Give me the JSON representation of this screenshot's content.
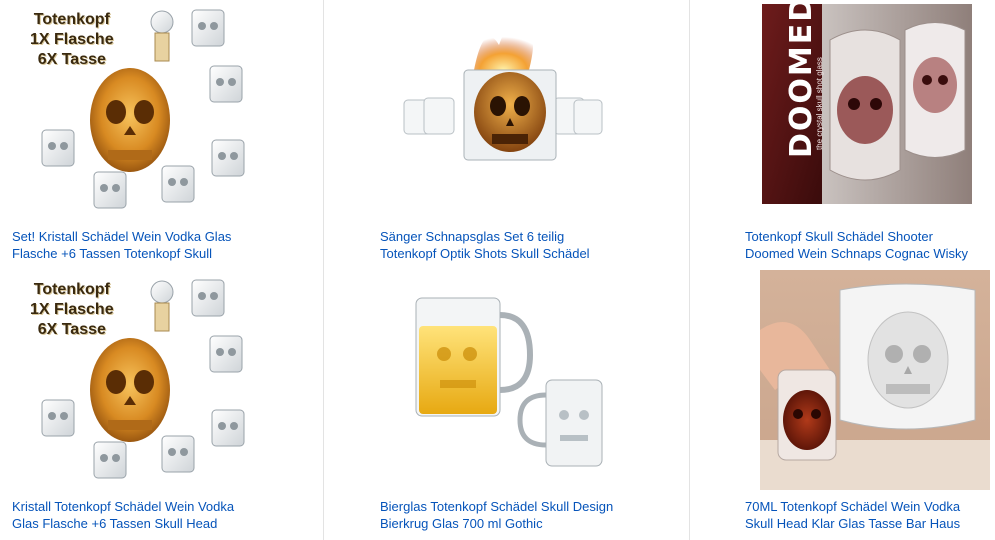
{
  "products": [
    {
      "line1": "Set! Kristall Schädel Wein Vodka Glas",
      "line2": "Flasche +6 Tassen Totenkopf Skull",
      "image": "skull-decanter-set-image",
      "overlay": [
        "Totenkopf",
        "1X Flasche",
        "6X Tasse"
      ]
    },
    {
      "line1": "Sänger Schnapsglas Set 6 teilig",
      "line2": "Totenkopf Optik Shots Skull Schädel",
      "image": "skull-shot-glasses-flame-image"
    },
    {
      "line1": "Totenkopf Skull Schädel Shooter",
      "line2": "Doomed Wein Schnaps Cognac Wisky",
      "image": "doomed-skull-glass-box-image",
      "box_logo": "DOOMED",
      "box_sub": "the crystal skull shot glass"
    },
    {
      "line1": "Kristall Totenkopf Schädel Wein Vodka",
      "line2": "Glas Flasche +6 Tassen Skull Head",
      "image": "skull-decanter-set-image",
      "overlay": [
        "Totenkopf",
        "1X Flasche",
        "6X Tasse"
      ]
    },
    {
      "line1": "Bierglas Totenkopf Schädel Skull Design",
      "line2": "Bierkrug Glas 700 ml Gothic",
      "image": "skull-beer-mugs-image"
    },
    {
      "line1": "70ML Totenkopf Schädel Wein Vodka",
      "line2": "Skull Head Klar Glas Tasse Bar Haus",
      "image": "hand-holding-skull-glass-image"
    }
  ],
  "colors": {
    "link": "#0654ba",
    "divider": "#e3e3e3"
  }
}
